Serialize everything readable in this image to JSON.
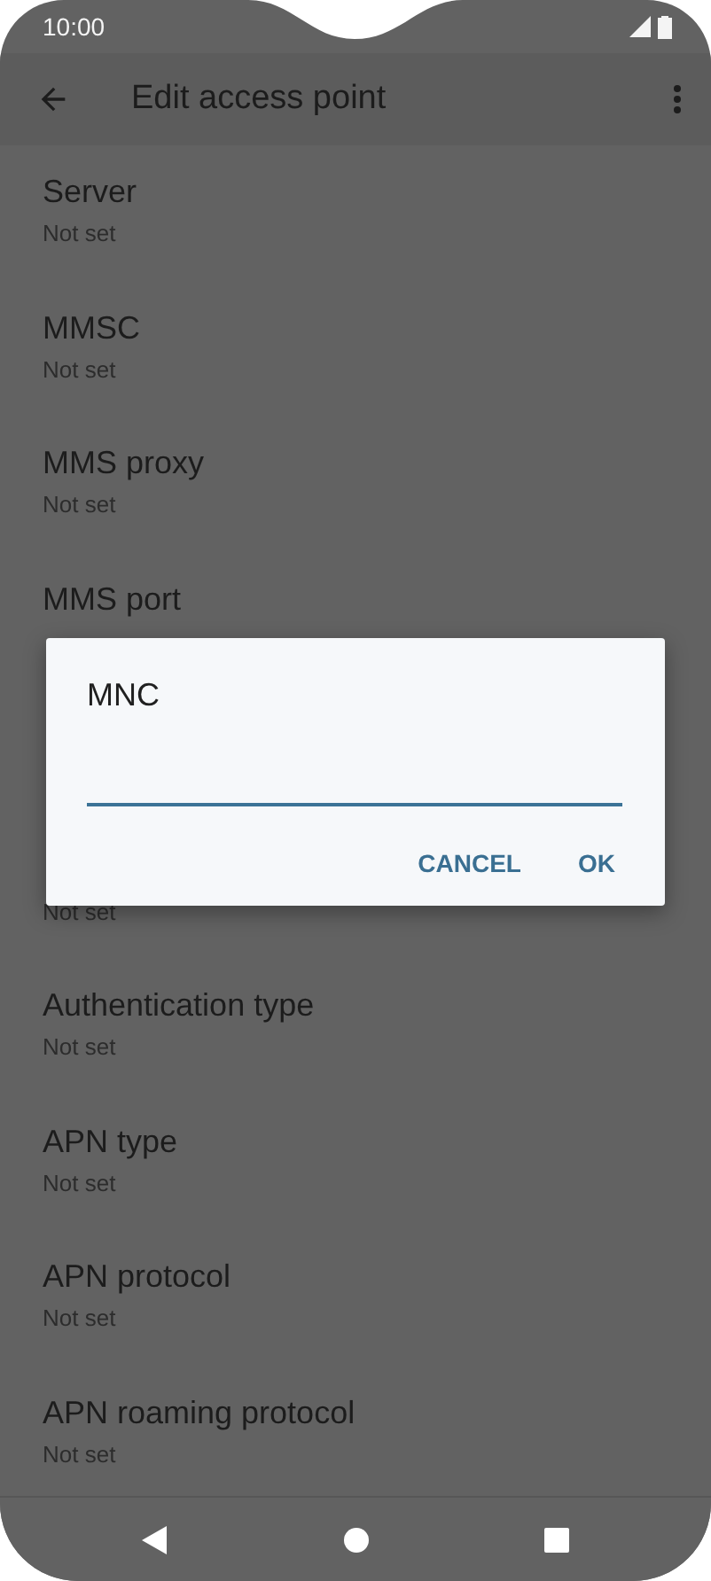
{
  "status_bar": {
    "time": "10:00"
  },
  "app_bar": {
    "title": "Edit access point"
  },
  "items": [
    {
      "kind": "setting",
      "title": "Server",
      "subtitle": "Not set"
    },
    {
      "kind": "setting",
      "title": "MMSC",
      "subtitle": "Not set"
    },
    {
      "kind": "setting",
      "title": "MMS proxy",
      "subtitle": "Not set"
    },
    {
      "kind": "setting",
      "title": "MMS port"
    },
    {
      "kind": "covered"
    },
    {
      "kind": "setting",
      "subtitle": "Not set"
    },
    {
      "kind": "setting",
      "title": "Authentication type",
      "subtitle": "Not set"
    },
    {
      "kind": "setting",
      "title": "APN type",
      "subtitle": "Not set"
    },
    {
      "kind": "setting",
      "title": "APN protocol",
      "subtitle": "Not set"
    },
    {
      "kind": "setting",
      "title": "APN roaming protocol",
      "subtitle": "Not set"
    }
  ],
  "dialog": {
    "title": "MNC",
    "buttons": [
      "CANCEL",
      "OK"
    ]
  }
}
